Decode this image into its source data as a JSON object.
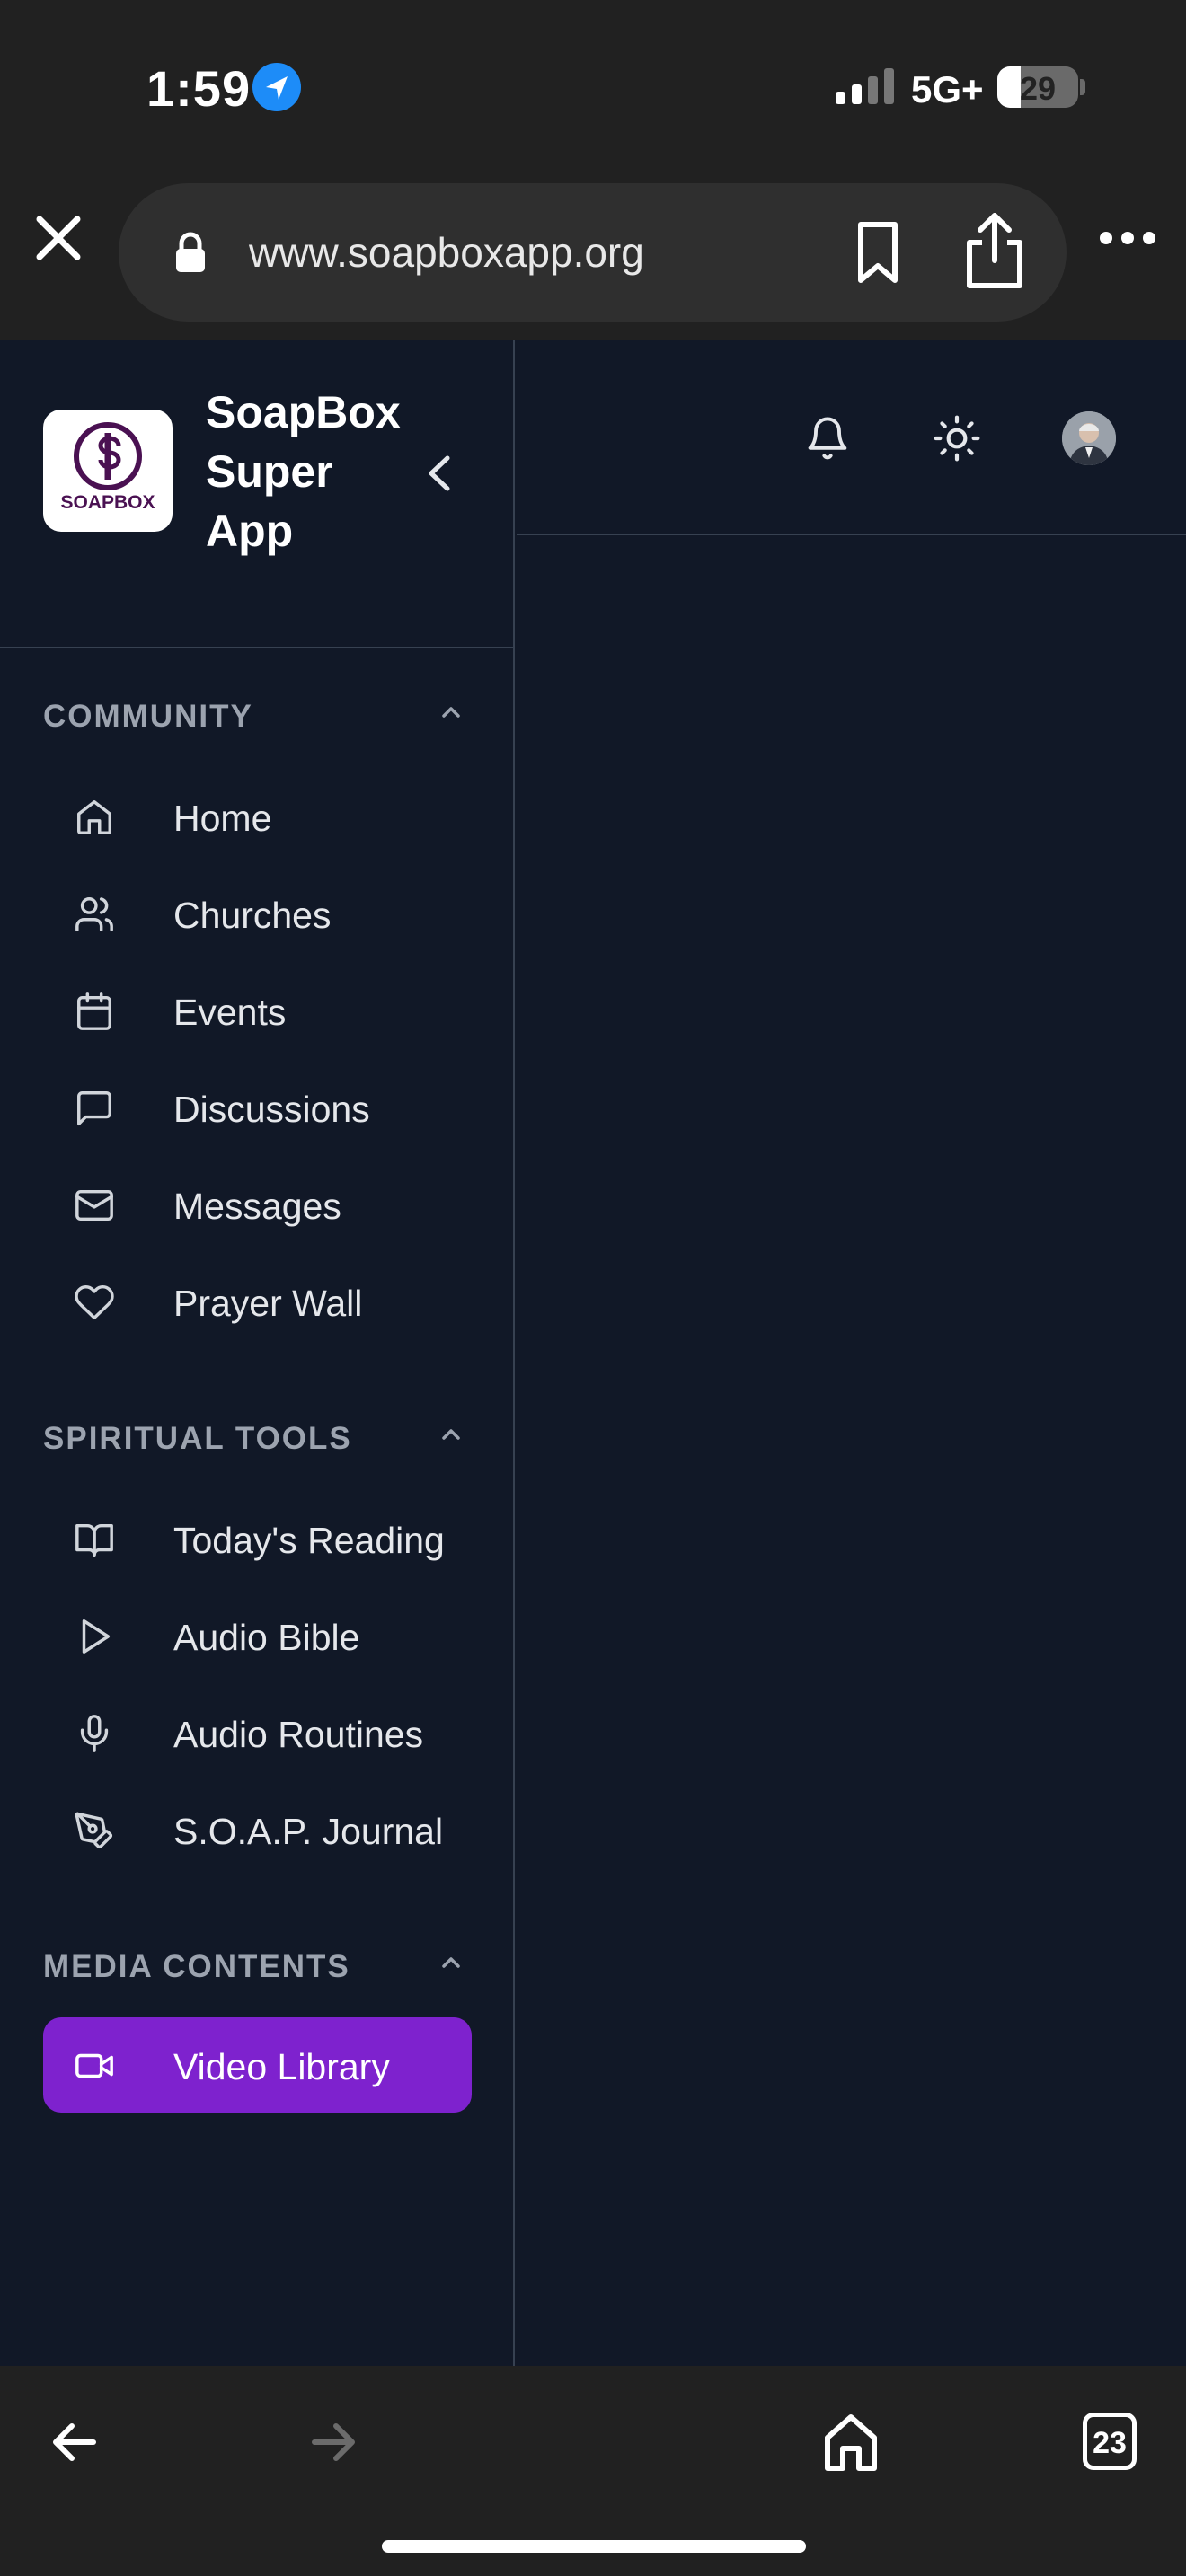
{
  "status_bar": {
    "time": "1:59",
    "network": "5G+",
    "battery": "29",
    "battery_level": 0.29
  },
  "browser": {
    "url": "www.soapboxapp.org",
    "tab_count": "23"
  },
  "app": {
    "brand": {
      "logo_text": "SOAPBOX",
      "title": "SoapBox Super App"
    },
    "sections": [
      {
        "label": "COMMUNITY",
        "items": [
          {
            "label": "Home",
            "icon": "home-icon"
          },
          {
            "label": "Churches",
            "icon": "users-icon"
          },
          {
            "label": "Events",
            "icon": "calendar-icon"
          },
          {
            "label": "Discussions",
            "icon": "chat-bubble-icon"
          },
          {
            "label": "Messages",
            "icon": "mail-icon"
          },
          {
            "label": "Prayer Wall",
            "icon": "heart-icon"
          }
        ]
      },
      {
        "label": "SPIRITUAL TOOLS",
        "items": [
          {
            "label": "Today's Reading",
            "icon": "book-open-icon"
          },
          {
            "label": "Audio Bible",
            "icon": "play-icon"
          },
          {
            "label": "Audio Routines",
            "icon": "microphone-icon"
          },
          {
            "label": "S.O.A.P. Journal",
            "icon": "pen-tool-icon"
          }
        ]
      },
      {
        "label": "MEDIA CONTENTS",
        "items": [
          {
            "label": "Video Library",
            "icon": "video-camera-icon",
            "active": true
          }
        ]
      }
    ]
  },
  "colors": {
    "app_background": "#111827",
    "border": "#374151",
    "section_label": "#9ca3af",
    "active_item": "#7e22ce",
    "brand_logo": "#4a1152"
  }
}
